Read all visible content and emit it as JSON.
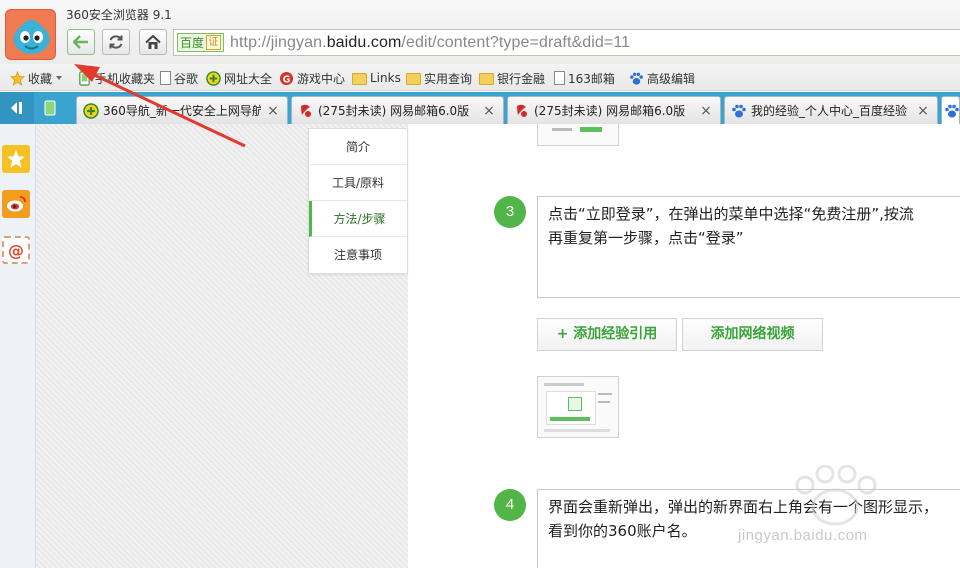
{
  "window": {
    "title": "360安全浏览器 9.1"
  },
  "address": {
    "cert_label": "百度",
    "cert_mark": "证",
    "url_prefix": "http://jingyan.",
    "url_host": "baidu.com",
    "url_suffix": "/edit/content?type=draft&did=11"
  },
  "bookmarks": [
    {
      "label": "收藏",
      "icon": "star-icon"
    },
    {
      "label": "手机收藏夹",
      "icon": "phone-bookmark-icon"
    },
    {
      "label": "谷歌",
      "icon": "page-icon"
    },
    {
      "label": "网址大全",
      "icon": "360-icon"
    },
    {
      "label": "游戏中心",
      "icon": "game-center-icon"
    },
    {
      "label": "Links",
      "icon": "folder-icon"
    },
    {
      "label": "实用查询",
      "icon": "folder-icon"
    },
    {
      "label": "银行金融",
      "icon": "folder-icon"
    },
    {
      "label": "163邮箱",
      "icon": "page-icon"
    },
    {
      "label": "高级编辑",
      "icon": "baidu-paw-icon"
    }
  ],
  "tabs": [
    {
      "label": "360导航_新一代安全上网导航",
      "icon": "360-icon",
      "close": "×"
    },
    {
      "label": "(275封未读) 网易邮箱6.0版",
      "icon": "netease-mail-icon",
      "close": "×"
    },
    {
      "label": "(275封未读) 网易邮箱6.0版",
      "icon": "netease-mail-icon",
      "close": "×"
    },
    {
      "label": "我的经验_个人中心_百度经验",
      "icon": "baidu-paw-icon",
      "close": "×"
    }
  ],
  "outline": [
    {
      "label": "简介",
      "active": false
    },
    {
      "label": "工具/原料",
      "active": false
    },
    {
      "label": "方法/步骤",
      "active": true
    },
    {
      "label": "注意事项",
      "active": false
    }
  ],
  "steps": [
    {
      "number": "3",
      "line1": "点击“立即登录”，在弹出的菜单中选择“免费注册”,按流",
      "line2": "再重复第一步骤，点击“登录”"
    },
    {
      "number": "4",
      "line1": "界面会重新弹出，弹出的新界面右上角会有一个图形显示，",
      "line2": "看到你的360账户名。"
    }
  ],
  "actions": {
    "add_reference": "+ 添加经验引用",
    "add_video": "添加网络视频"
  },
  "watermark": "jingyan.baidu.com",
  "colors": {
    "accent_green": "#52b548",
    "tabbar_blue": "#3aa3cf",
    "arrow_red": "#e23b2e"
  }
}
